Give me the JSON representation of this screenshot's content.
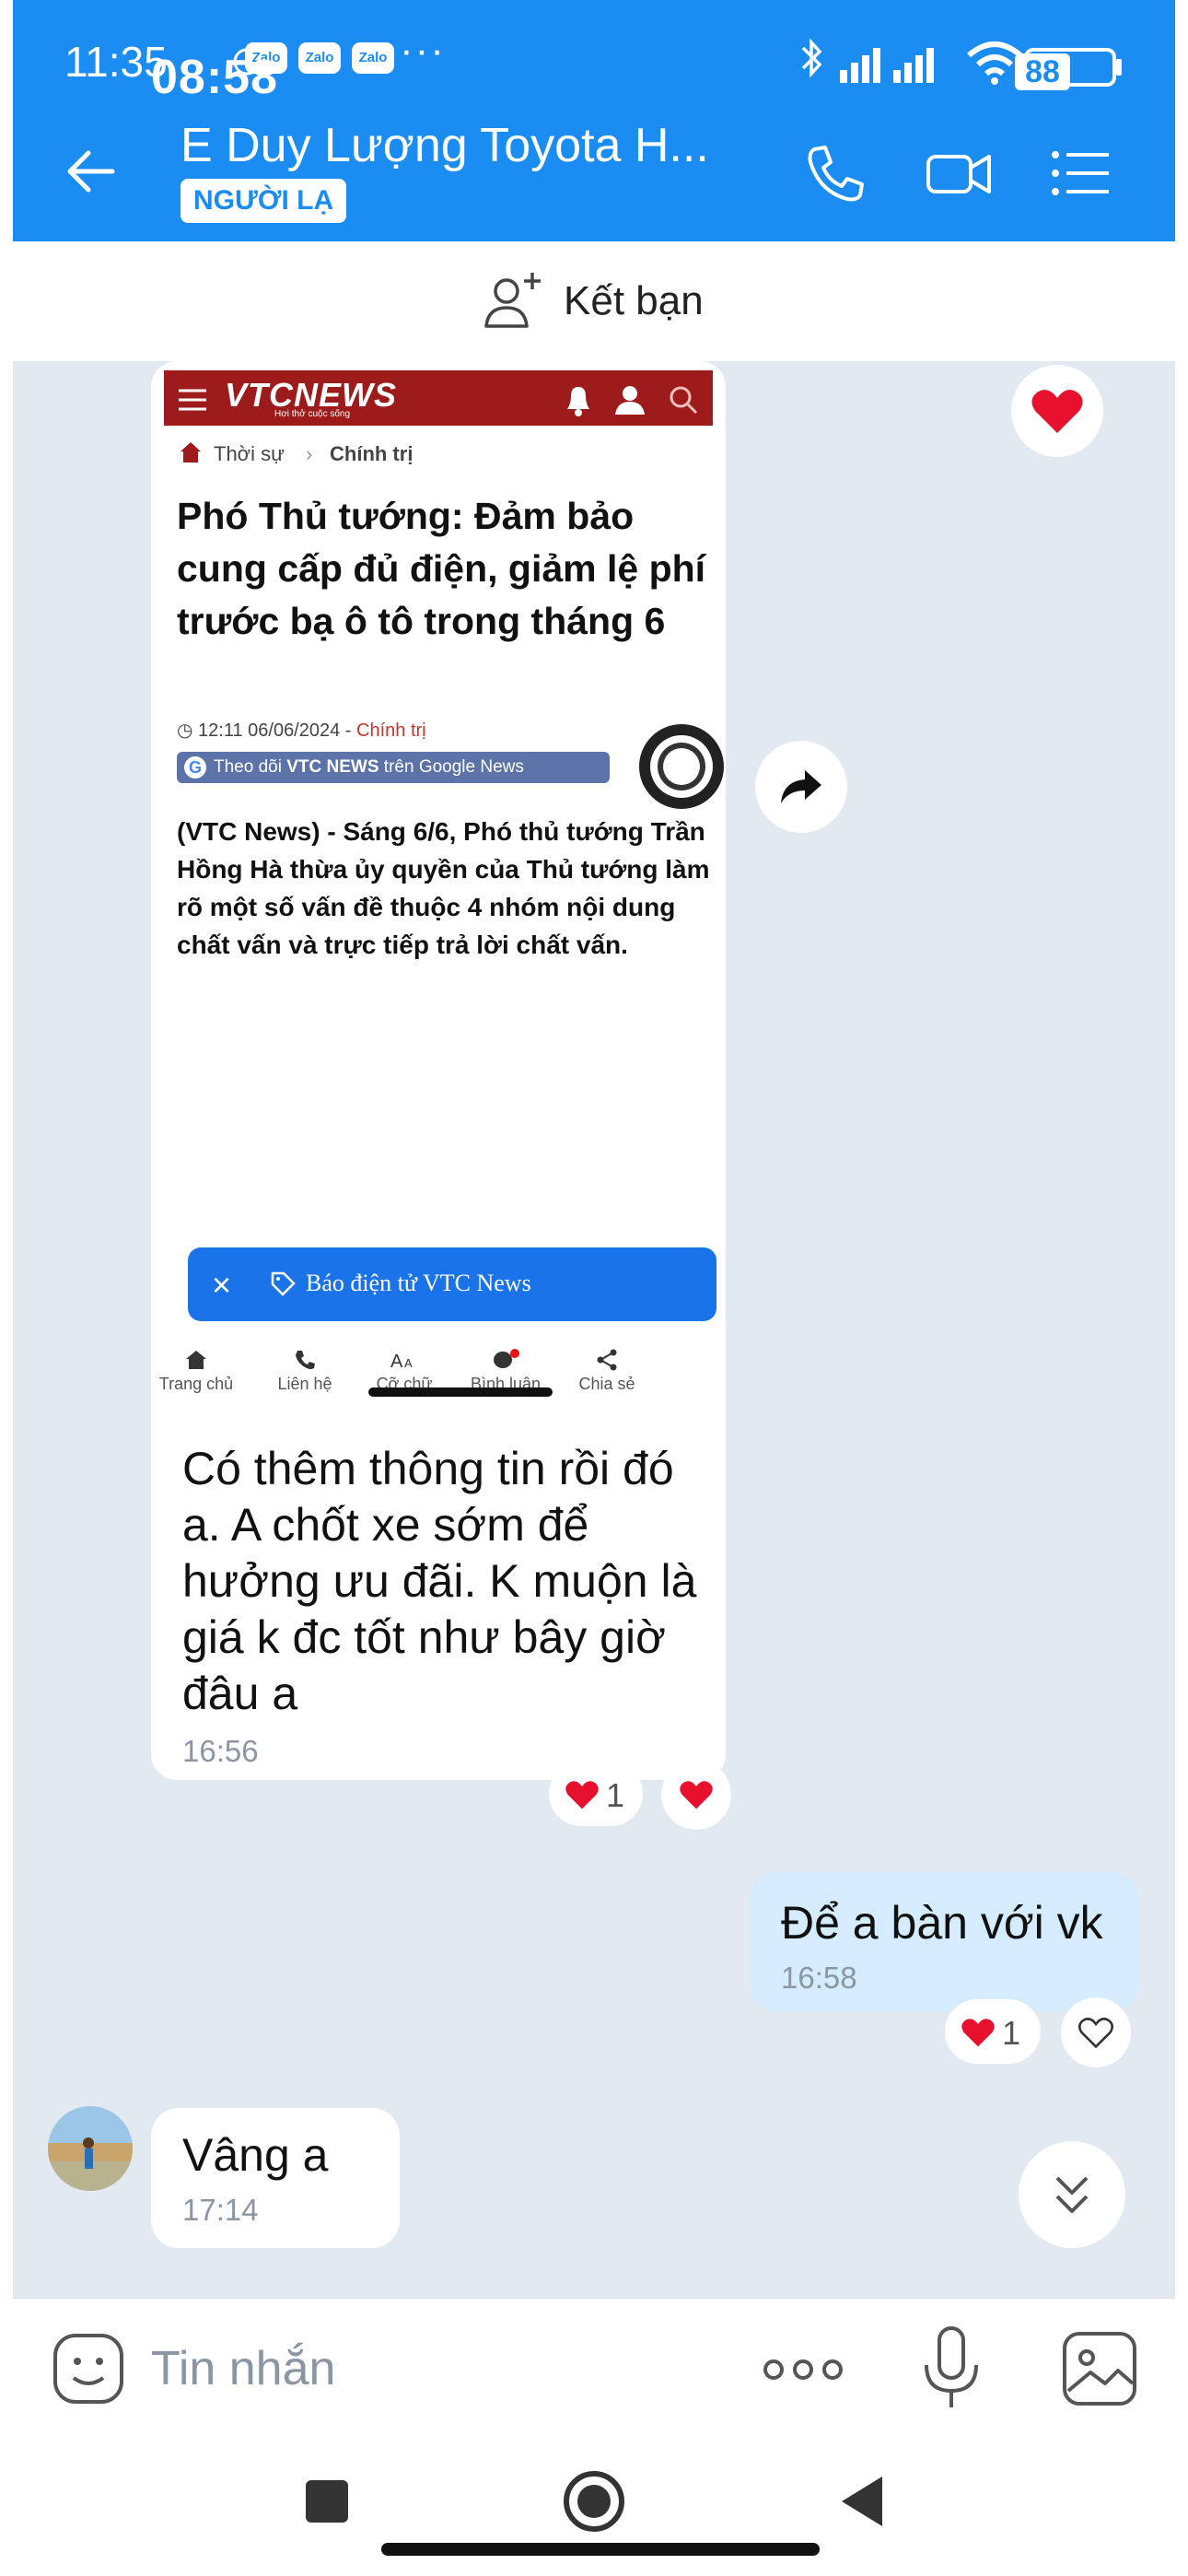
{
  "status_bar": {
    "time": "11:35",
    "overlay_time": "08:58",
    "app_badges": [
      "Zalo",
      "Zalo",
      "Zalo"
    ],
    "more": "···",
    "battery": "88",
    "battery_overlay": "14"
  },
  "header": {
    "title": "E Duy Lượng Toyota H...",
    "badge": "NGƯỜI LẠ"
  },
  "add_friend": {
    "label": "Kết bạn"
  },
  "shared_screenshot": {
    "site_logo": "VTCNEWS",
    "site_tagline": "Hơi thở cuộc sống",
    "breadcrumb": [
      "Thời sự",
      "Chính trị"
    ],
    "article_title": "Phó Thủ tướng: Đảm bảo cung cấp đủ điện, giảm lệ phí trước bạ ô tô trong tháng 6",
    "article_time": "12:11 06/06/2024 - ",
    "article_category": "Chính trị",
    "follow_prefix": "Theo dõi ",
    "follow_brand": "VTC NEWS",
    "follow_mid": " trên ",
    "follow_gnews": "Google News",
    "article_lead": "(VTC News) - Sáng 6/6, Phó thủ tướng Trần Hồng Hà thừa ủy quyền của Thủ tướng làm rõ một số vấn đề thuộc 4 nhóm nội dung chất vấn và trực tiếp trả lời chất vấn.",
    "pill_close": "×",
    "pill_text": "Báo điện tử VTC News",
    "nav": [
      "Trang chủ",
      "Liên hệ",
      "Cỡ chữ",
      "Bình luận",
      "Chia sẻ"
    ]
  },
  "messages": {
    "incoming_1": {
      "text": "Có thêm thông tin rồi đó a. A chốt xe sớm để hưởng ưu đãi. K muộn là giá k đc tốt như bây giờ đâu a",
      "time": "16:56",
      "reaction_count": "1"
    },
    "outgoing_1": {
      "text": "Để a bàn với vk",
      "time": "16:58",
      "reaction_count": "1"
    },
    "incoming_2": {
      "text": "Vâng a",
      "time": "17:14"
    }
  },
  "input": {
    "placeholder": "Tin nhắn",
    "more": "ooo"
  },
  "colors": {
    "brand": "#1a8cf2",
    "chat_bg": "#e2e9f1",
    "outgoing_bubble": "#d4ecfe",
    "heart": "#e8112d",
    "vtc_red": "#9e1b1b"
  },
  "icons": [
    "back-arrow-icon",
    "phone-icon",
    "video-call-icon",
    "list-menu-icon",
    "add-friend-icon",
    "heart-icon",
    "forward-icon",
    "scroll-down-icon",
    "emoji-icon",
    "mic-icon",
    "gallery-icon"
  ]
}
